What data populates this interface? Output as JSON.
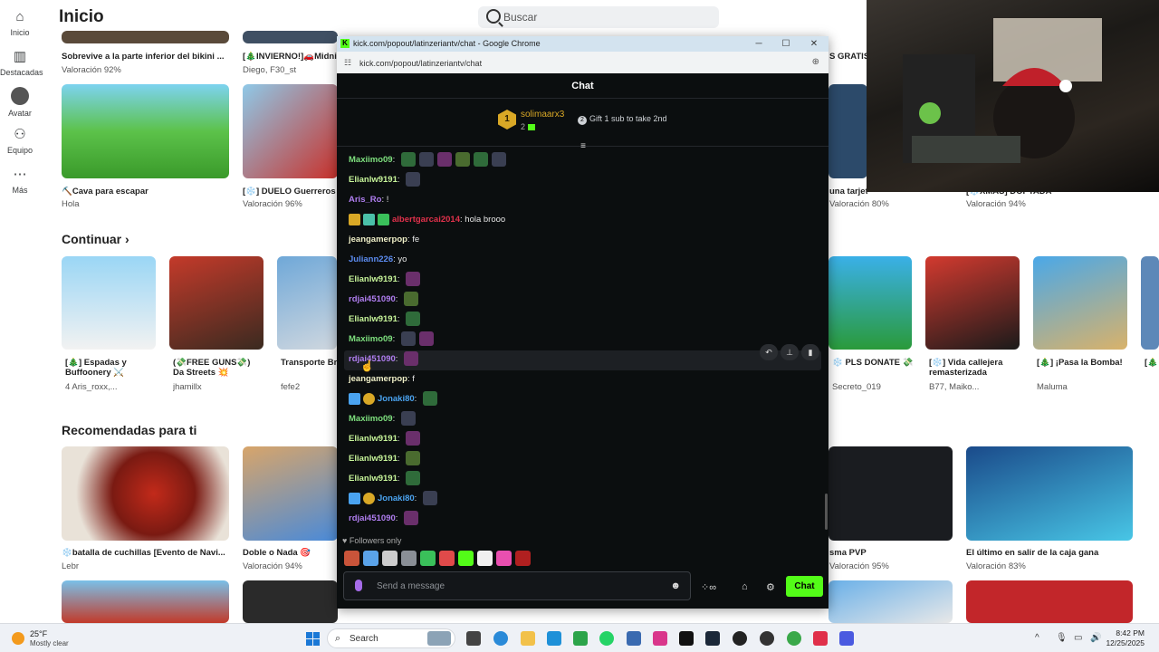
{
  "colors": {
    "kick_green": "#53fc18",
    "chat_bg": "#0b0e0f",
    "gold": "#d9a826"
  },
  "nav": {
    "items": [
      {
        "label": "Inicio",
        "icon": "home-icon"
      },
      {
        "label": "Destacadas",
        "icon": "charts-icon"
      },
      {
        "label": "Avatar",
        "icon": "avatar-icon"
      },
      {
        "label": "Equipo",
        "icon": "team-icon"
      },
      {
        "label": "Más",
        "icon": "more-icon"
      }
    ]
  },
  "page": {
    "title": "Inicio",
    "search_placeholder": "Buscar"
  },
  "row1": [
    {
      "title": "Sobrevive a la parte inferior del bikini ...",
      "sub": "Valoración 92%"
    },
    {
      "title": "[🎄INVIERNO!]🚗Midnig",
      "sub": "Diego, F30_st"
    },
    {
      "title": "S GRATIS",
      "sub": ""
    }
  ],
  "row2": [
    {
      "title": "⛏️Cava para escapar",
      "sub": "Hola"
    },
    {
      "title": "[❄️] DUELO Guerreros",
      "sub": "Valoración 96%"
    },
    {
      "title": "una tarjeta de baloncesto",
      "sub": "Valoración 80%"
    },
    {
      "title": "[❄️XMAS] DOPTADA",
      "sub": "Valoración 94%"
    }
  ],
  "sections": {
    "continuar": "Continuar",
    "recomendadas": "Recomendadas para ti"
  },
  "continuar": [
    {
      "title": "[🎄] Espadas y Buffoonery ⚔️",
      "sub": "Aris_roxx,...",
      "count": "4"
    },
    {
      "title": "(💸FREE GUNS💸) Da Streets 💥",
      "sub": "jhamillx",
      "count": ""
    },
    {
      "title": "Transporte Br",
      "sub": "fefe2",
      "count": ""
    },
    {
      "title": "❄️ PLS DONATE 💸",
      "sub": "Secreto_019",
      "count": ""
    },
    {
      "title": "[❄️] Vida callejera remasterizada",
      "sub": "B77, Maiko...",
      "count": ""
    },
    {
      "title": "[🎄] ¡Pasa la Bomba!",
      "sub": "Maluma",
      "count": ""
    },
    {
      "title": "[🎄",
      "sub": "",
      "count": ""
    }
  ],
  "recomendadas": [
    {
      "title": "❄️batalla de cuchillas [Evento de Navi...",
      "sub": "Lebr"
    },
    {
      "title": "Doble o Nada 🎯",
      "sub": "Valoración 94%"
    },
    {
      "title": "sma PVP",
      "sub": "Valoración 95%"
    },
    {
      "title": "El último en salir de la caja gana",
      "sub": "Valoración 83%"
    }
  ],
  "chrome": {
    "title": "kick.com/popout/latinzeriantv/chat - Google Chrome",
    "url": "kick.com/popout/latinzeriantv/chat"
  },
  "chat": {
    "header": "Chat",
    "pinned": {
      "user": "solimaarx3",
      "rank": "1",
      "count": "2",
      "gift_text": "Gift 1 sub to take 2nd",
      "gift_rank": "2"
    },
    "messages": [
      {
        "user": "Maxiimo09",
        "color": "#7ee07e",
        "text": "",
        "emotes": 6
      },
      {
        "user": "Elianlw9191",
        "color": "#c7f59a",
        "text": "",
        "emotes": 1
      },
      {
        "user": "Aris_Ro",
        "color": "#b07ef0",
        "text": "!",
        "emotes": 0
      },
      {
        "user": "albertgarcai2014",
        "color": "#e0314b",
        "text": "hola brooo",
        "emotes": 0
      },
      {
        "user": "jeangamerpop",
        "color": "#f0f0c8",
        "text": "fe",
        "emotes": 0
      },
      {
        "user": "Juliann226",
        "color": "#5c8cf0",
        "text": "yo",
        "emotes": 0
      },
      {
        "user": "Elianlw9191",
        "color": "#c7f59a",
        "text": "",
        "emotes": 1
      },
      {
        "user": "rdjai451090",
        "color": "#b07ef0",
        "text": "",
        "emotes": 1
      },
      {
        "user": "Elianlw9191",
        "color": "#c7f59a",
        "text": "",
        "emotes": 1
      },
      {
        "user": "Maxiimo09",
        "color": "#7ee07e",
        "text": "",
        "emotes": 2
      },
      {
        "user": "rdjai451090",
        "color": "#b07ef0",
        "text": "",
        "emotes": 1
      },
      {
        "user": "jeangamerpop",
        "color": "#f0f0c8",
        "text": "f",
        "emotes": 0
      },
      {
        "user": "Jonaki80",
        "color": "#4aa3f0",
        "text": "",
        "emotes": 1
      },
      {
        "user": "Maxiimo09",
        "color": "#7ee07e",
        "text": "",
        "emotes": 1
      },
      {
        "user": "Elianlw9191",
        "color": "#c7f59a",
        "text": "",
        "emotes": 1
      },
      {
        "user": "Elianlw9191",
        "color": "#c7f59a",
        "text": "",
        "emotes": 1
      },
      {
        "user": "Elianlw9191",
        "color": "#c7f59a",
        "text": "",
        "emotes": 1
      },
      {
        "user": "Jonaki80",
        "color": "#4aa3f0",
        "text": "",
        "emotes": 1
      },
      {
        "user": "rdjai451090",
        "color": "#b07ef0",
        "text": "",
        "emotes": 1
      }
    ],
    "followers_only": "Followers only",
    "input_placeholder": "Send a message",
    "send_label": "Chat"
  },
  "taskbar": {
    "temp": "25°F",
    "weather": "Mostly clear",
    "search": "Search",
    "time": "8:42 PM",
    "date": "12/25/2025"
  }
}
